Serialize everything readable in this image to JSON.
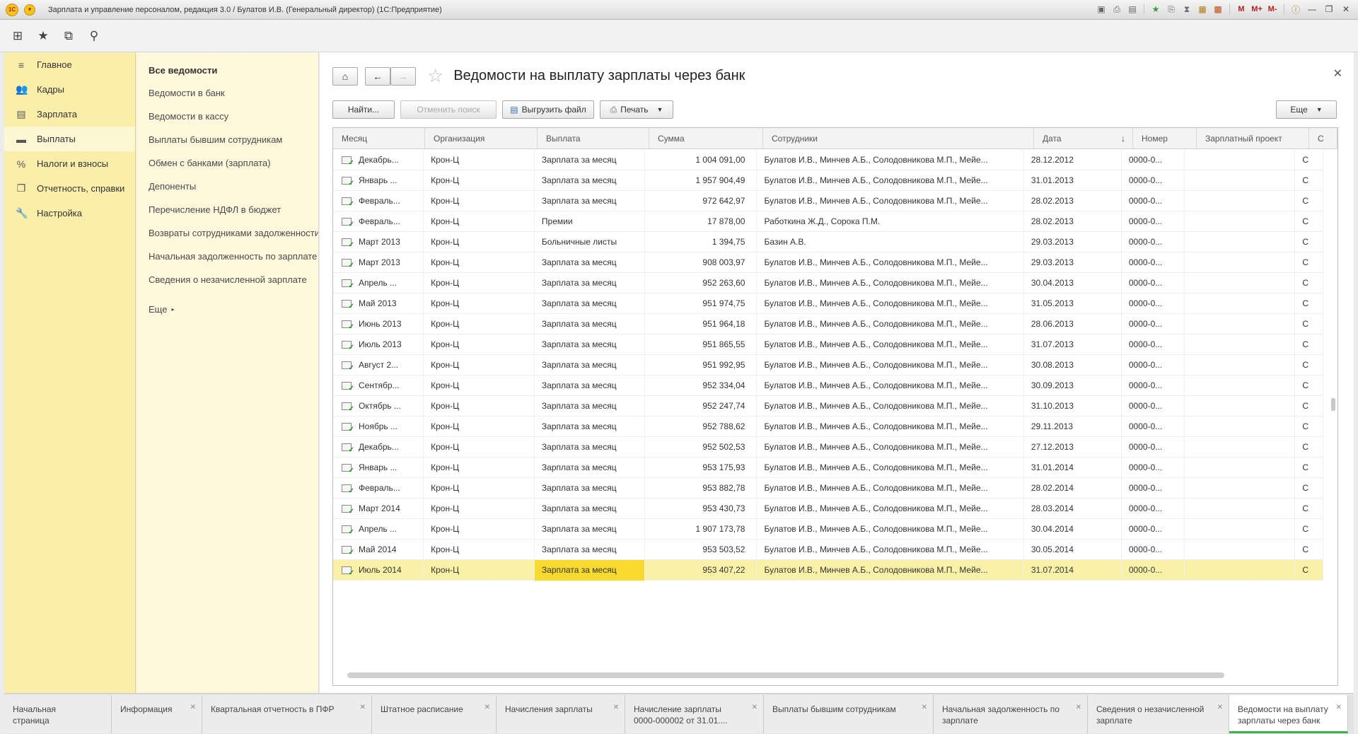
{
  "window": {
    "title": "Зарплата и управление персоналом, редакция 3.0 / Булатов И.В. (Генеральный директор)  (1С:Предприятие)",
    "logo_text": "1С",
    "tools": [
      "M",
      "M+",
      "M-"
    ]
  },
  "sections": [
    {
      "label": "Главное",
      "icon": "menu-icon",
      "glyph": "≡"
    },
    {
      "label": "Кадры",
      "icon": "people-icon",
      "glyph": "👥"
    },
    {
      "label": "Зарплата",
      "icon": "calculator-icon",
      "glyph": "▤"
    },
    {
      "label": "Выплаты",
      "icon": "card-icon",
      "glyph": "▬"
    },
    {
      "label": "Налоги и взносы",
      "icon": "percent-icon",
      "glyph": "%"
    },
    {
      "label": "Отчетность, справки",
      "icon": "report-icon",
      "glyph": "❐"
    },
    {
      "label": "Настройка",
      "icon": "wrench-icon",
      "glyph": "🔧"
    }
  ],
  "nav": {
    "header": "Все ведомости",
    "links": [
      "Ведомости в банк",
      "Ведомости в кассу",
      "Выплаты бывшим сотрудникам",
      "Обмен с банками (зарплата)",
      "Депоненты",
      "Перечисление НДФЛ в бюджет",
      "Возвраты сотрудниками задолженности",
      "Начальная задолженность по зарплате",
      "Сведения о незачисленной зарплате"
    ],
    "more": "Еще"
  },
  "form": {
    "title": "Ведомости на выплату зарплаты через банк",
    "buttons": {
      "find": "Найти...",
      "cancel_search": "Отменить поиск",
      "export": "Выгрузить файл",
      "print": "Печать",
      "more": "Еще"
    }
  },
  "table": {
    "columns": [
      "Месяц",
      "Организация",
      "Выплата",
      "Сумма",
      "Сотрудники",
      "Дата",
      "Номер",
      "Зарплатный проект",
      "С"
    ],
    "rows": [
      [
        "Декабрь...",
        "Крон-Ц",
        "Зарплата за месяц",
        "1 004 091,00",
        "Булатов И.В., Минчев А.Б., Солодовникова М.П., Мейе...",
        "28.12.2012",
        "0000-0...",
        "",
        "С"
      ],
      [
        "Январь ...",
        "Крон-Ц",
        "Зарплата за месяц",
        "1 957 904,49",
        "Булатов И.В., Минчев А.Б., Солодовникова М.П., Мейе...",
        "31.01.2013",
        "0000-0...",
        "",
        "С"
      ],
      [
        "Февраль...",
        "Крон-Ц",
        "Зарплата за месяц",
        "972 642,97",
        "Булатов И.В., Минчев А.Б., Солодовникова М.П., Мейе...",
        "28.02.2013",
        "0000-0...",
        "",
        "С"
      ],
      [
        "Февраль...",
        "Крон-Ц",
        "Премии",
        "17 878,00",
        "Работкина Ж.Д., Сорока П.М.",
        "28.02.2013",
        "0000-0...",
        "",
        "С"
      ],
      [
        "Март 2013",
        "Крон-Ц",
        "Больничные листы",
        "1 394,75",
        "Базин А.В.",
        "29.03.2013",
        "0000-0...",
        "",
        "С"
      ],
      [
        "Март 2013",
        "Крон-Ц",
        "Зарплата за месяц",
        "908 003,97",
        "Булатов И.В., Минчев А.Б., Солодовникова М.П., Мейе...",
        "29.03.2013",
        "0000-0...",
        "",
        "С"
      ],
      [
        "Апрель ...",
        "Крон-Ц",
        "Зарплата за месяц",
        "952 263,60",
        "Булатов И.В., Минчев А.Б., Солодовникова М.П., Мейе...",
        "30.04.2013",
        "0000-0...",
        "",
        "С"
      ],
      [
        "Май 2013",
        "Крон-Ц",
        "Зарплата за месяц",
        "951 974,75",
        "Булатов И.В., Минчев А.Б., Солодовникова М.П., Мейе...",
        "31.05.2013",
        "0000-0...",
        "",
        "С"
      ],
      [
        "Июнь 2013",
        "Крон-Ц",
        "Зарплата за месяц",
        "951 964,18",
        "Булатов И.В., Минчев А.Б., Солодовникова М.П., Мейе...",
        "28.06.2013",
        "0000-0...",
        "",
        "С"
      ],
      [
        "Июль 2013",
        "Крон-Ц",
        "Зарплата за месяц",
        "951 865,55",
        "Булатов И.В., Минчев А.Б., Солодовникова М.П., Мейе...",
        "31.07.2013",
        "0000-0...",
        "",
        "С"
      ],
      [
        "Август 2...",
        "Крон-Ц",
        "Зарплата за месяц",
        "951 992,95",
        "Булатов И.В., Минчев А.Б., Солодовникова М.П., Мейе...",
        "30.08.2013",
        "0000-0...",
        "",
        "С"
      ],
      [
        "Сентябр...",
        "Крон-Ц",
        "Зарплата за месяц",
        "952 334,04",
        "Булатов И.В., Минчев А.Б., Солодовникова М.П., Мейе...",
        "30.09.2013",
        "0000-0...",
        "",
        "С"
      ],
      [
        "Октябрь ...",
        "Крон-Ц",
        "Зарплата за месяц",
        "952 247,74",
        "Булатов И.В., Минчев А.Б., Солодовникова М.П., Мейе...",
        "31.10.2013",
        "0000-0...",
        "",
        "С"
      ],
      [
        "Ноябрь ...",
        "Крон-Ц",
        "Зарплата за месяц",
        "952 788,62",
        "Булатов И.В., Минчев А.Б., Солодовникова М.П., Мейе...",
        "29.11.2013",
        "0000-0...",
        "",
        "С"
      ],
      [
        "Декабрь...",
        "Крон-Ц",
        "Зарплата за месяц",
        "952 502,53",
        "Булатов И.В., Минчев А.Б., Солодовникова М.П., Мейе...",
        "27.12.2013",
        "0000-0...",
        "",
        "С"
      ],
      [
        "Январь ...",
        "Крон-Ц",
        "Зарплата за месяц",
        "953 175,93",
        "Булатов И.В., Минчев А.Б., Солодовникова М.П., Мейе...",
        "31.01.2014",
        "0000-0...",
        "",
        "С"
      ],
      [
        "Февраль...",
        "Крон-Ц",
        "Зарплата за месяц",
        "953 882,78",
        "Булатов И.В., Минчев А.Б., Солодовникова М.П., Мейе...",
        "28.02.2014",
        "0000-0...",
        "",
        "С"
      ],
      [
        "Март 2014",
        "Крон-Ц",
        "Зарплата за месяц",
        "953 430,73",
        "Булатов И.В., Минчев А.Б., Солодовникова М.П., Мейе...",
        "28.03.2014",
        "0000-0...",
        "",
        "С"
      ],
      [
        "Апрель ...",
        "Крон-Ц",
        "Зарплата за месяц",
        "1 907 173,78",
        "Булатов И.В., Минчев А.Б., Солодовникова М.П., Мейе...",
        "30.04.2014",
        "0000-0...",
        "",
        "С"
      ],
      [
        "Май 2014",
        "Крон-Ц",
        "Зарплата за месяц",
        "953 503,52",
        "Булатов И.В., Минчев А.Б., Солодовникова М.П., Мейе...",
        "30.05.2014",
        "0000-0...",
        "",
        "С"
      ],
      [
        "Июль 2014",
        "Крон-Ц",
        "Зарплата за месяц",
        "953 407,22",
        "Булатов И.В., Минчев А.Б., Солодовникова М.П., Мейе...",
        "31.07.2014",
        "0000-0...",
        "",
        "С"
      ]
    ]
  },
  "tabs": [
    {
      "label": "Начальная страница",
      "closable": false
    },
    {
      "label": "Информация",
      "closable": true
    },
    {
      "label": "Квартальная отчетность в ПФР",
      "closable": true
    },
    {
      "label": "Штатное расписание",
      "closable": true
    },
    {
      "label": "Начисления зарплаты",
      "closable": true
    },
    {
      "label": "Начисление зарплаты 0000-000002 от 31.01....",
      "closable": true
    },
    {
      "label": "Выплаты бывшим сотрудникам",
      "closable": true
    },
    {
      "label": "Начальная задолженность по зарплате",
      "closable": true
    },
    {
      "label": "Сведения о незачисленной зарплате",
      "closable": true
    },
    {
      "label": "Ведомости на выплату зарплаты через банк",
      "closable": true
    }
  ],
  "state": {
    "active_section": "Выплаты",
    "selected_row": "Июль 2014",
    "active_tab": "Ведомости на выплату зарплаты через банк",
    "sort_column": "Дата"
  },
  "colors": {
    "section_bg": "#fbeeaa",
    "nav_bg": "#fdf8dc",
    "selected_row": "#faf1a9",
    "selected_cell": "#f7d930",
    "active_tab_accent": "#3bb34a"
  }
}
